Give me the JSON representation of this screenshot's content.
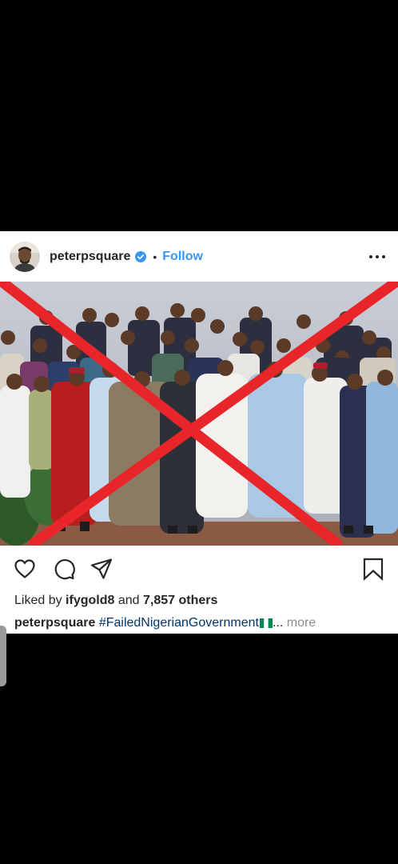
{
  "post": {
    "username": "peterpsquare",
    "separator": "•",
    "follow_label": "Follow",
    "verified": true,
    "photo_alt_icon": "group-photo-with-red-x",
    "likes": {
      "prefix": "Liked by",
      "user": "ifygold8",
      "connector": "and",
      "count": "7,857 others"
    },
    "caption": {
      "user": "peterpsquare",
      "hashtag": "#FailedNigerianGovernment",
      "ellipsis": "...",
      "more": "more"
    }
  },
  "colors": {
    "accent_blue": "#3897f0",
    "hashtag_blue": "#003569",
    "cross_red": "#e8262a",
    "muted": "#8e8e8e"
  },
  "icons": {
    "like": "heart-icon",
    "comment": "comment-icon",
    "share": "direct-share-icon",
    "save": "bookmark-icon",
    "options": "more-options-icon"
  }
}
